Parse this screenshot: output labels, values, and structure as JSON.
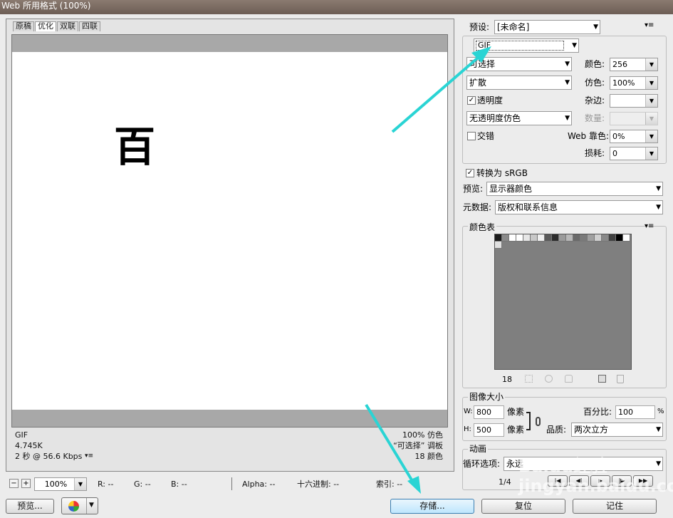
{
  "window": {
    "title": "Web 所用格式 (100%)"
  },
  "tabs": [
    "原稿",
    "优化",
    "双联",
    "四联"
  ],
  "canvas": {
    "glyph": "百"
  },
  "image_info": {
    "left": [
      "GIF",
      "4.745K",
      "2 秒 @ 56.6 Kbps"
    ],
    "right": [
      "100% 仿色",
      "“可选择” 调板",
      "18 颜色"
    ]
  },
  "statusbar": {
    "zoom": "100%",
    "r": "R: --",
    "g": "G: --",
    "b": "B: --",
    "alpha": "Alpha: --",
    "hex": "十六进制: --",
    "index": "索引: --"
  },
  "buttons": {
    "preview": "预览...",
    "save": "存储...",
    "reset": "复位",
    "remember": "记住"
  },
  "settings": {
    "preset_label": "预设:",
    "preset_value": "[未命名]",
    "format": "GIF",
    "reduction": "可选择",
    "dither_algo": "扩散",
    "transparency_label": "透明度",
    "transparency_dither": "无透明度仿色",
    "interlace_label": "交错",
    "colors_label": "颜色:",
    "colors_value": "256",
    "dither_label": "仿色:",
    "dither_value": "100%",
    "matte_label": "杂边:",
    "matte_value": "",
    "amount_label": "数量:",
    "amount_value": "",
    "websnap_label": "Web 靠色:",
    "websnap_value": "0%",
    "lossy_label": "损耗:",
    "lossy_value": "0",
    "convert_srgb": "转换为 sRGB",
    "preview_label": "预览:",
    "preview_value": "显示器颜色",
    "metadata_label": "元数据:",
    "metadata_value": "版权和联系信息"
  },
  "color_table": {
    "title": "颜色表",
    "count": "18",
    "swatches": [
      "#1a1a1a",
      "#8a8a8a",
      "#ffffff",
      "#ffffff",
      "#e6e6e6",
      "#c8c8c8",
      "#f0f0f0",
      "#5a5a5a",
      "#2c2c2c",
      "#9a9a9a",
      "#b8b8b8",
      "#6a6a6a",
      "#7a7a7a",
      "#a0a0a0",
      "#d0d0d0",
      "#888888",
      "#404040",
      "#000000",
      "#ffffff",
      "#e0e0e0"
    ]
  },
  "image_size": {
    "title": "图像大小",
    "w_label": "W:",
    "w_value": "800",
    "w_unit": "像素",
    "h_label": "H:",
    "h_value": "500",
    "h_unit": "像素",
    "percent_label": "百分比:",
    "percent_value": "100",
    "percent_unit": "%",
    "quality_label": "品质:",
    "quality_value": "两次立方"
  },
  "animation": {
    "title": "动画",
    "loop_label": "循环选项:",
    "loop_value": "永远",
    "frame": "1/4"
  },
  "watermark": "Baidu经验  jingyan.baidu.com",
  "colors": {
    "arrow": "#2ad4d4"
  }
}
